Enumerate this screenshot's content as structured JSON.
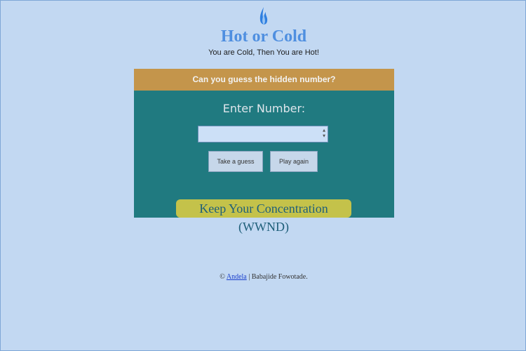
{
  "header": {
    "logo_icon": "flame-icon",
    "title": "Hot or Cold",
    "subtitle": "You are Cold, Then You are Hot!"
  },
  "game": {
    "question": "Can you guess the hidden number?",
    "enter_label": "Enter Number:",
    "number_value": "",
    "guess_button": "Take a guess",
    "play_again_button": "Play again",
    "status_message": "Keep Your Concentration (WWND)"
  },
  "footer": {
    "copyright": "©",
    "link_text": "Andela",
    "author": "| Babajide Fowotade."
  },
  "colors": {
    "background": "#c2d8f2",
    "title": "#4f8fe0",
    "game_panel": "#207a80",
    "question_bar": "#c4954b",
    "message_badge": "#c4c24a"
  }
}
